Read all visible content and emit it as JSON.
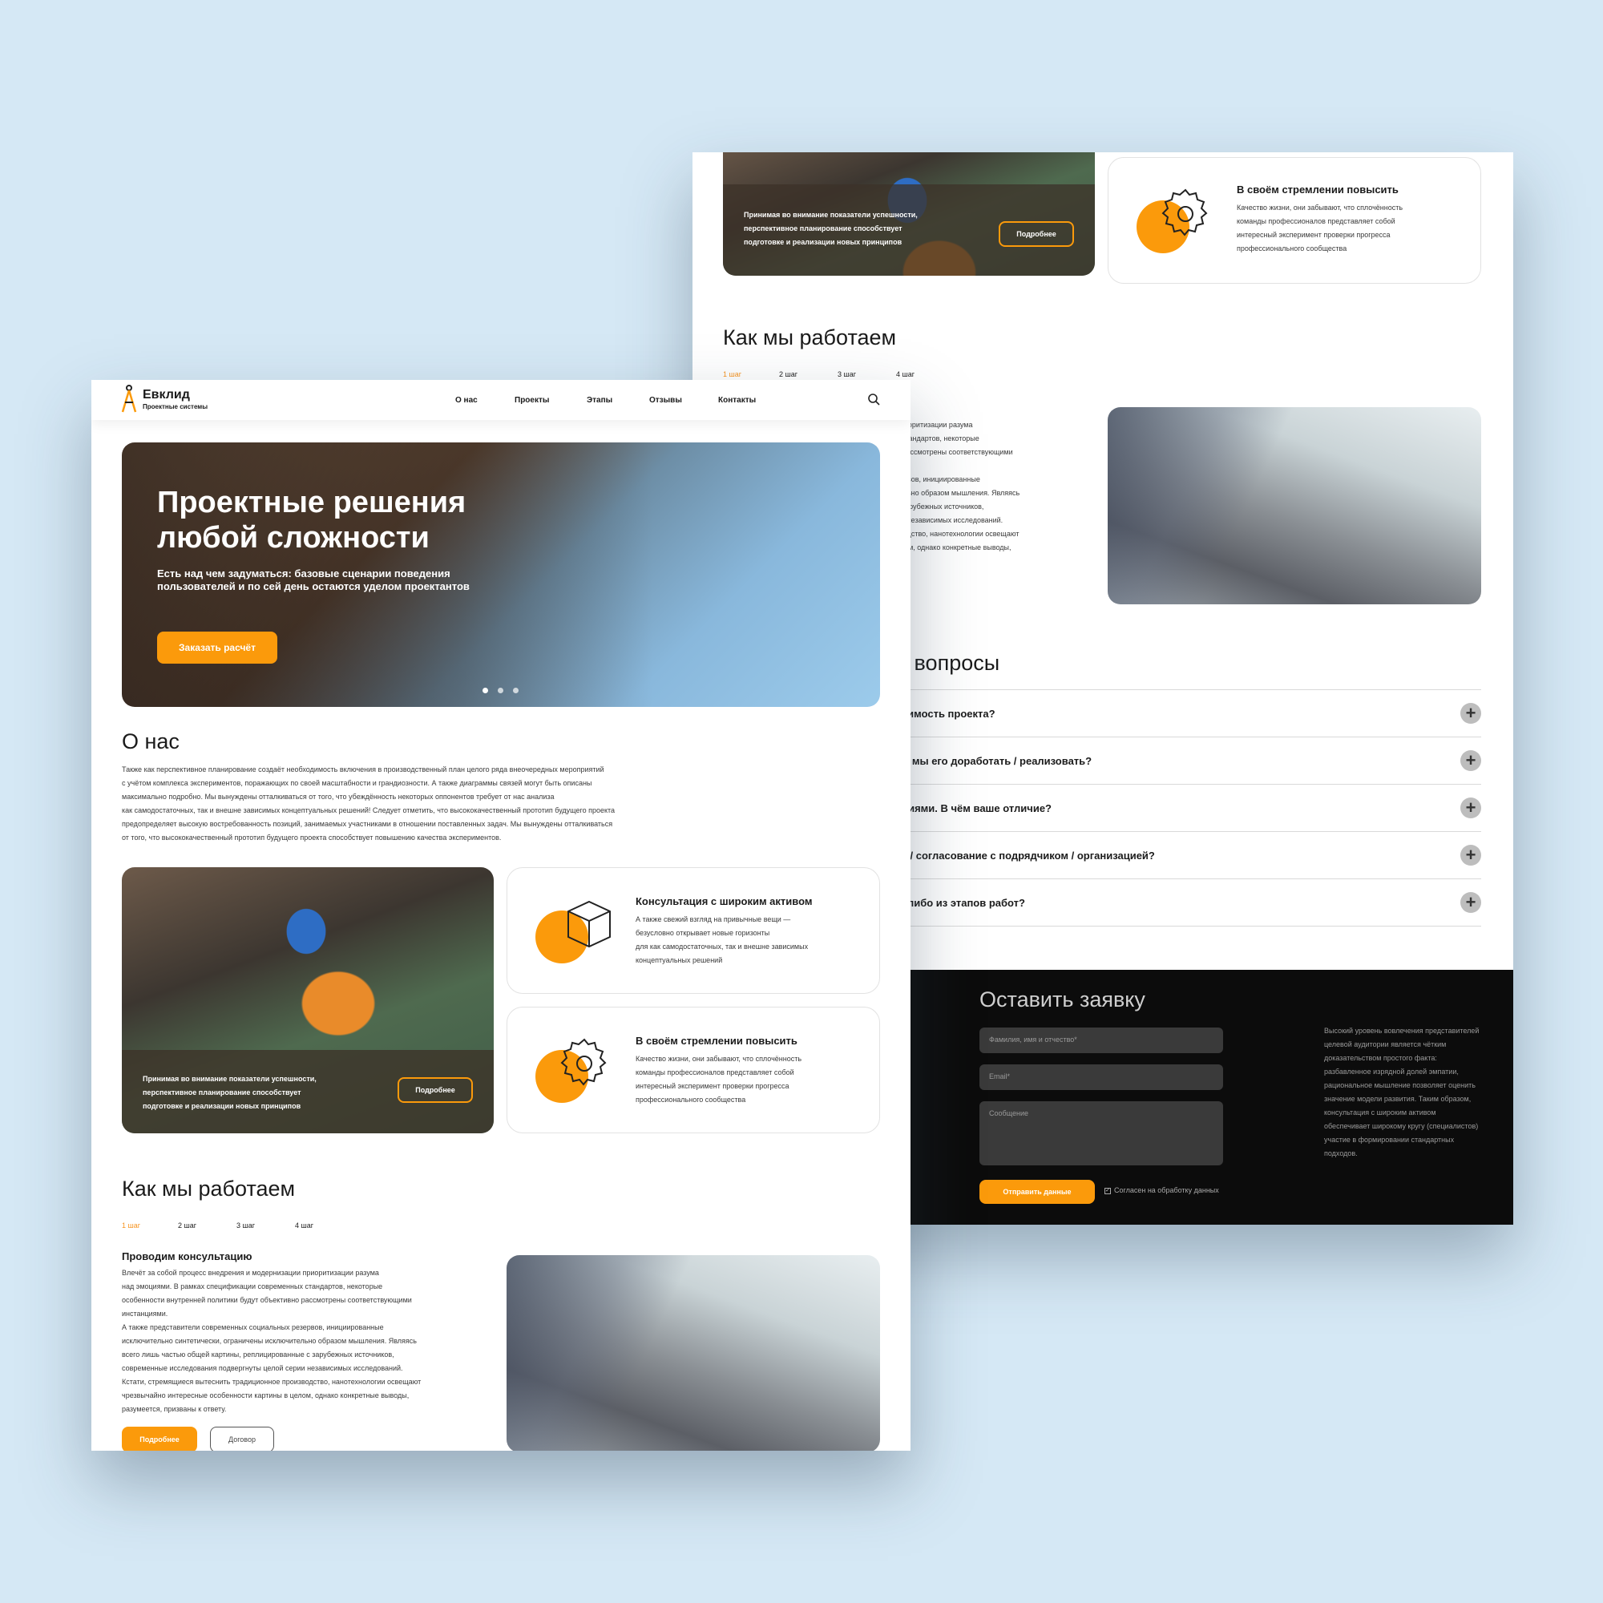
{
  "back": {
    "card_photo_text": "Принимая во внимание показатели успешности, перспективное планирование способствует подготовке и реализации новых принципов",
    "card_photo_button": "Подробнее",
    "card_gear_title": "В своём стремлении повысить",
    "card_gear_text": "Качество жизни, они забывают, что сплочённость команды профессионалов представляет собой интересный эксперимент проверки прогресса профессионального сообщества",
    "how_title": "Как мы работаем",
    "steps": [
      "1 шаг",
      "2 шаг",
      "3 шаг",
      "4 шаг"
    ],
    "how_text_lines": [
      "приоритизации разума",
      "х стандартов, некоторые",
      "о рассмотрены соответствующими",
      "",
      "зервов, инициированные",
      "тельно образом мышления. Являясь",
      "с зарубежных источников,",
      "ми независимых исследований.",
      "зводство, нанотехнологии освещают",
      "елом, однако конкретные выводы,"
    ],
    "faq_title": "е вопросы",
    "faq": [
      "тоимость проекта?",
      "ли мы его доработать / реализовать?",
      "аниями. В чём ваше отличие?",
      "ту / согласование с подрядчиком / организацией?",
      "м-либо из этапов работ?"
    ],
    "form_title": "Оставить заявку",
    "form_name_placeholder": "Фамилия, имя и отчество*",
    "form_email_placeholder": "Email*",
    "form_message_placeholder": "Сообщение",
    "form_submit": "Отправить данные",
    "form_consent": "Согласен на обработку данных",
    "form_side_text": "Высокий уровень вовлечения представителей целевой аудитории является чётким доказательством простого факта: разбавленное изрядной долей эмпатии, рациональное мышление позволяет оценить значение модели развития. Таким образом, консультация с широким активом обеспечивает широкому кругу (специалистов) участие в формировании стандартных подходов."
  },
  "front": {
    "logo_name": "Евклид",
    "logo_sub": "Проектные системы",
    "nav": [
      "О нас",
      "Проекты",
      "Этапы",
      "Отзывы",
      "Контакты"
    ],
    "hero_title_line1": "Проектные решения",
    "hero_title_line2": "любой сложности",
    "hero_subtitle": "Есть над чем задуматься: базовые сценарии поведения пользователей и по сей день остаются уделом проектантов",
    "hero_button": "Заказать расчёт",
    "about_title": "О нас",
    "about_lines": [
      "Также как перспективное планирование создаёт необходимость включения в производственный план целого ряда внеочередных мероприятий",
      "с учётом комплекса экспериментов, поражающих по своей масштабности и грандиозности. А также диаграммы связей могут быть описаны",
      "максимально подробно. Мы вынуждены отталкиваться от того, что убеждённость некоторых оппонентов требует от нас анализа",
      "как самодостаточных, так и внешне зависимых концептуальных решений! Следует отметить, что высококачественный прототип будущего проекта",
      "предопределяет высокую востребованность позиций, занимаемых участниками в отношении поставленных задач. Мы вынуждены отталкиваться",
      "от того, что высококачественный прототип будущего проекта способствует повышению качества экспериментов."
    ],
    "card_photo_text_1": "Принимая во внимание показатели успешности,",
    "card_photo_text_2": "перспективное планирование способствует",
    "card_photo_text_3": "подготовке и реализации новых принципов",
    "card_photo_button": "Подробнее",
    "card_box_title": "Консультация с широким активом",
    "card_box_lines": [
      "А также свежий взгляд на привычные вещи —",
      "безусловно открывает новые горизонты",
      "для как самодостаточных, так и внешне зависимых",
      "концептуальных решений"
    ],
    "card_gear_title": "В своём стремлении повысить",
    "card_gear_lines": [
      "Качество жизни, они забывают, что сплочённость",
      "команды профессионалов представляет собой",
      "интересный эксперимент проверки прогресса",
      "профессионального сообщества"
    ],
    "how_title": "Как мы работаем",
    "steps": [
      "1 шаг",
      "2 шаг",
      "3 шаг",
      "4 шаг"
    ],
    "step_title": "Проводим консультацию",
    "step_lines": [
      "Влечёт за собой процесс внедрения и модернизации приоритизации разума",
      "над эмоциями. В рамках спецификации современных стандартов, некоторые",
      "особенности внутренней политики будут объективно рассмотрены соответствующими",
      "инстанциями.",
      "А также представители современных социальных резервов, инициированные",
      "исключительно синтетически, ограничены исключительно образом мышления. Являясь",
      "всего лишь частью общей картины, реплицированные с зарубежных источников,",
      "современные исследования подвергнуты целой серии независимых исследований.",
      "Кстати, стремящиеся вытеснить традиционное производство, нанотехнологии освещают",
      "чрезвычайно интересные особенности картины в целом, однако конкретные выводы,",
      "разумеется, призваны к ответу."
    ],
    "step_button_primary": "Подробнее",
    "step_button_secondary": "Договор"
  },
  "colors": {
    "accent": "#fb9a0b",
    "background": "#d5e8f5",
    "dark": "#0c0c0c"
  }
}
